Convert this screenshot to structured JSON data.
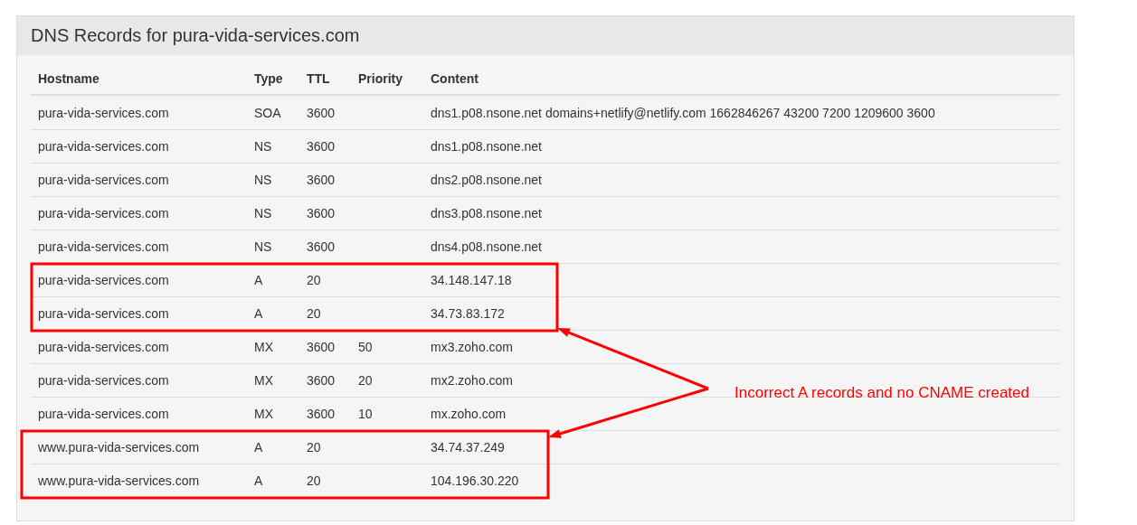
{
  "panel": {
    "title": "DNS Records for pura-vida-services.com"
  },
  "table": {
    "columns": [
      "Hostname",
      "Type",
      "TTL",
      "Priority",
      "Content"
    ],
    "rows": [
      {
        "hostname": "pura-vida-services.com",
        "type": "SOA",
        "ttl": "3600",
        "content": "dns1.p08.nsone.net domains+netlify@netlify.com 1662846267 43200 7200 1209600 3600",
        "flagged": false
      },
      {
        "hostname": "pura-vida-services.com",
        "type": "NS",
        "ttl": "3600",
        "content": "dns1.p08.nsone.net",
        "flagged": false
      },
      {
        "hostname": "pura-vida-services.com",
        "type": "NS",
        "ttl": "3600",
        "content": "dns2.p08.nsone.net",
        "flagged": false
      },
      {
        "hostname": "pura-vida-services.com",
        "type": "NS",
        "ttl": "3600",
        "content": "dns3.p08.nsone.net",
        "flagged": false
      },
      {
        "hostname": "pura-vida-services.com",
        "type": "NS",
        "ttl": "3600",
        "content": "dns4.p08.nsone.net",
        "flagged": false
      },
      {
        "hostname": "pura-vida-services.com",
        "type": "A",
        "ttl": "20",
        "content": "34.148.147.18",
        "flagged": true
      },
      {
        "hostname": "pura-vida-services.com",
        "type": "A",
        "ttl": "20",
        "content": "34.73.83.172",
        "flagged": true
      },
      {
        "hostname": "pura-vida-services.com",
        "type": "MX",
        "ttl": "3600",
        "priority": "50",
        "content": "mx3.zoho.com",
        "flagged": false
      },
      {
        "hostname": "pura-vida-services.com",
        "type": "MX",
        "ttl": "3600",
        "priority": "20",
        "content": "mx2.zoho.com",
        "flagged": false
      },
      {
        "hostname": "pura-vida-services.com",
        "type": "MX",
        "ttl": "3600",
        "priority": "10",
        "content": "mx.zoho.com",
        "flagged": false
      },
      {
        "hostname": "www.pura-vida-services.com",
        "type": "A",
        "ttl": "20",
        "content": "34.74.37.249",
        "flagged": true
      },
      {
        "hostname": "www.pura-vida-services.com",
        "type": "A",
        "ttl": "20",
        "content": "104.196.30.220",
        "flagged": true
      }
    ]
  },
  "annotation": {
    "text": "Incorrect A records and no CNAME created"
  }
}
